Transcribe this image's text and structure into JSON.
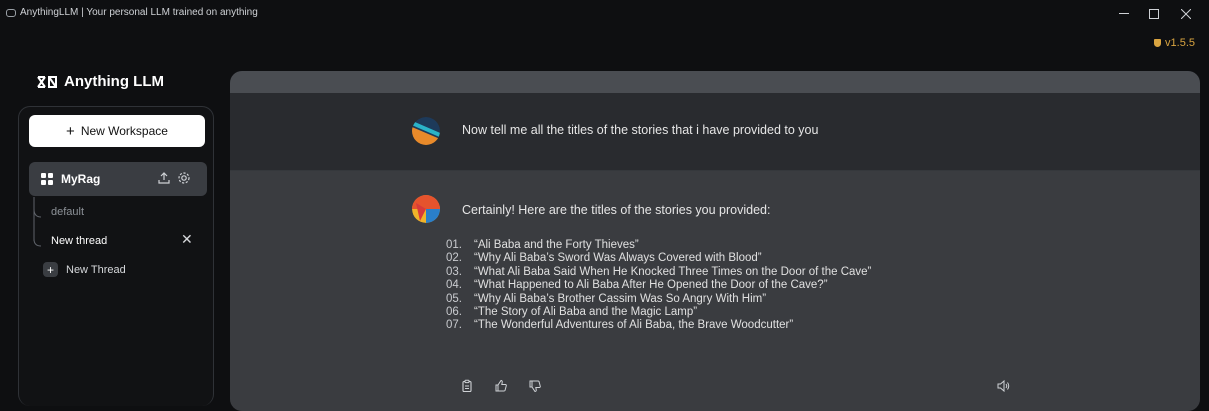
{
  "window": {
    "title": "AnythingLLM | Your personal LLM trained on anything",
    "version": "v1.5.5",
    "controls": [
      "minimize",
      "maximize",
      "close"
    ]
  },
  "brand": {
    "name": "Anything LLM"
  },
  "sidebar": {
    "new_workspace_label": "New Workspace",
    "workspace": {
      "name": "MyRag"
    },
    "threads": [
      {
        "label": "default",
        "active": false
      },
      {
        "label": "New thread",
        "active": true
      }
    ],
    "new_thread_label": "New Thread"
  },
  "chat": {
    "user_message": "Now tell me all the titles of the stories that i have provided to you",
    "assistant_intro": "Certainly! Here are the titles of the stories you provided:",
    "stories": [
      {
        "num": "01.",
        "title": "“Ali Baba and the Forty Thieves”"
      },
      {
        "num": "02.",
        "title": "“Why Ali Baba’s Sword Was Always Covered with Blood”"
      },
      {
        "num": "03.",
        "title": "“What Ali Baba Said When He Knocked Three Times on the Door of the Cave”"
      },
      {
        "num": "04.",
        "title": "“What Happened to Ali Baba After He Opened the Door of the Cave?”"
      },
      {
        "num": "05.",
        "title": "“Why Ali Baba’s Brother Cassim Was So Angry With Him”"
      },
      {
        "num": "06.",
        "title": "“The Story of Ali Baba and the Magic Lamp”"
      },
      {
        "num": "07.",
        "title": "“The Wonderful Adventures of Ali Baba, the Brave Woodcutter”"
      }
    ]
  },
  "colors": {
    "background": "#0e0f11",
    "accent_version": "#d9a440",
    "workspace_active": "#3a3d42",
    "assistant_bg": "#3a3c40",
    "user_bg": "#292b2f"
  }
}
